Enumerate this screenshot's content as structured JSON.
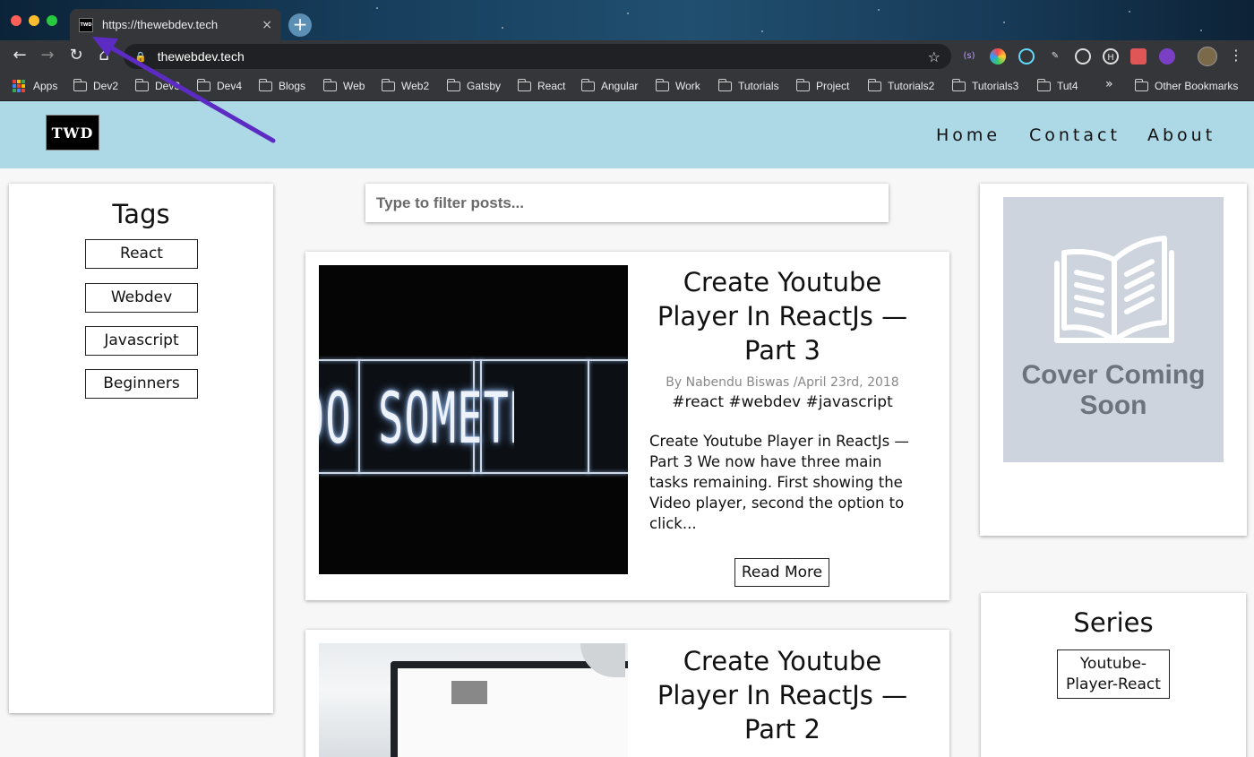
{
  "browser": {
    "tab_title": "https://thewebdev.tech",
    "tab_favicon_text": "TWD",
    "tab_close": "×",
    "new_tab": "+",
    "url": "thewebdev.tech",
    "bookmarks": [
      "Apps",
      "Dev2",
      "Dev3",
      "Dev4",
      "Blogs",
      "Web",
      "Web2",
      "Gatsby",
      "React",
      "Angular",
      "Work",
      "Tutorials",
      "Project",
      "Tutorials2",
      "Tutorials3",
      "Tut4"
    ],
    "overflow": "»",
    "other_bookmarks": "Other Bookmarks"
  },
  "header": {
    "logo_text": "TWD",
    "nav": [
      "Home",
      "Contact",
      "About"
    ],
    "background_color": "#add8e6"
  },
  "sidebar": {
    "tags_heading": "Tags",
    "tags": [
      "React",
      "Webdev",
      "Javascript",
      "Beginners"
    ]
  },
  "search": {
    "placeholder": "Type to filter posts..."
  },
  "posts": [
    {
      "image_text": "DO SOMETHING GREAT",
      "title": "Create Youtube Player In ReactJs — Part 3",
      "meta": "By Nabendu Biswas /April 23rd, 2018",
      "tags": "#react #webdev #javascript",
      "excerpt": "Create Youtube Player in ReactJs — Part 3 We now have three main tasks remaining. First showing the Video player, second the option to click...",
      "read_more": "Read More"
    },
    {
      "title": "Create Youtube Player In ReactJs — Part 2"
    }
  ],
  "cover": {
    "text": "Cover Coming Soon",
    "icon": "open-book-icon"
  },
  "series": {
    "heading": "Series",
    "items": [
      "Youtube-Player-React"
    ]
  },
  "annotation": {
    "arrow_color": "#5b2bc4"
  }
}
